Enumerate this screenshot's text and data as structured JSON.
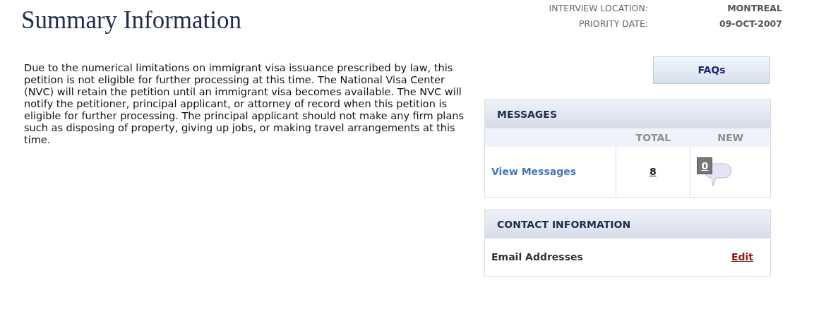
{
  "title": "Summary Information",
  "info": [
    {
      "label": "INTERVIEW LOCATION:",
      "value": "MONTREAL"
    },
    {
      "label": "PRIORITY DATE:",
      "value": "09-OCT-2007"
    }
  ],
  "notice": "Due to the numerical limitations on immigrant visa issuance prescribed by law, this petition is not eligible for further processing at this time. The National Visa Center (NVC) will retain the petition until an immigrant visa becomes available. The NVC will notify the petitioner, principal applicant, or attorney of record when this petition is eligible for further processing. The principal applicant should not make any firm plans such as disposing of property, giving up jobs, or making travel arrangements at this time.",
  "faq_button": "FAQs",
  "messages": {
    "title": "MESSAGES",
    "columns": [
      "TOTAL",
      "NEW"
    ],
    "link": "View Messages",
    "total": "8",
    "new": "0"
  },
  "contact": {
    "title": "CONTACT INFORMATION",
    "label": "Email Addresses",
    "action": "Edit"
  }
}
